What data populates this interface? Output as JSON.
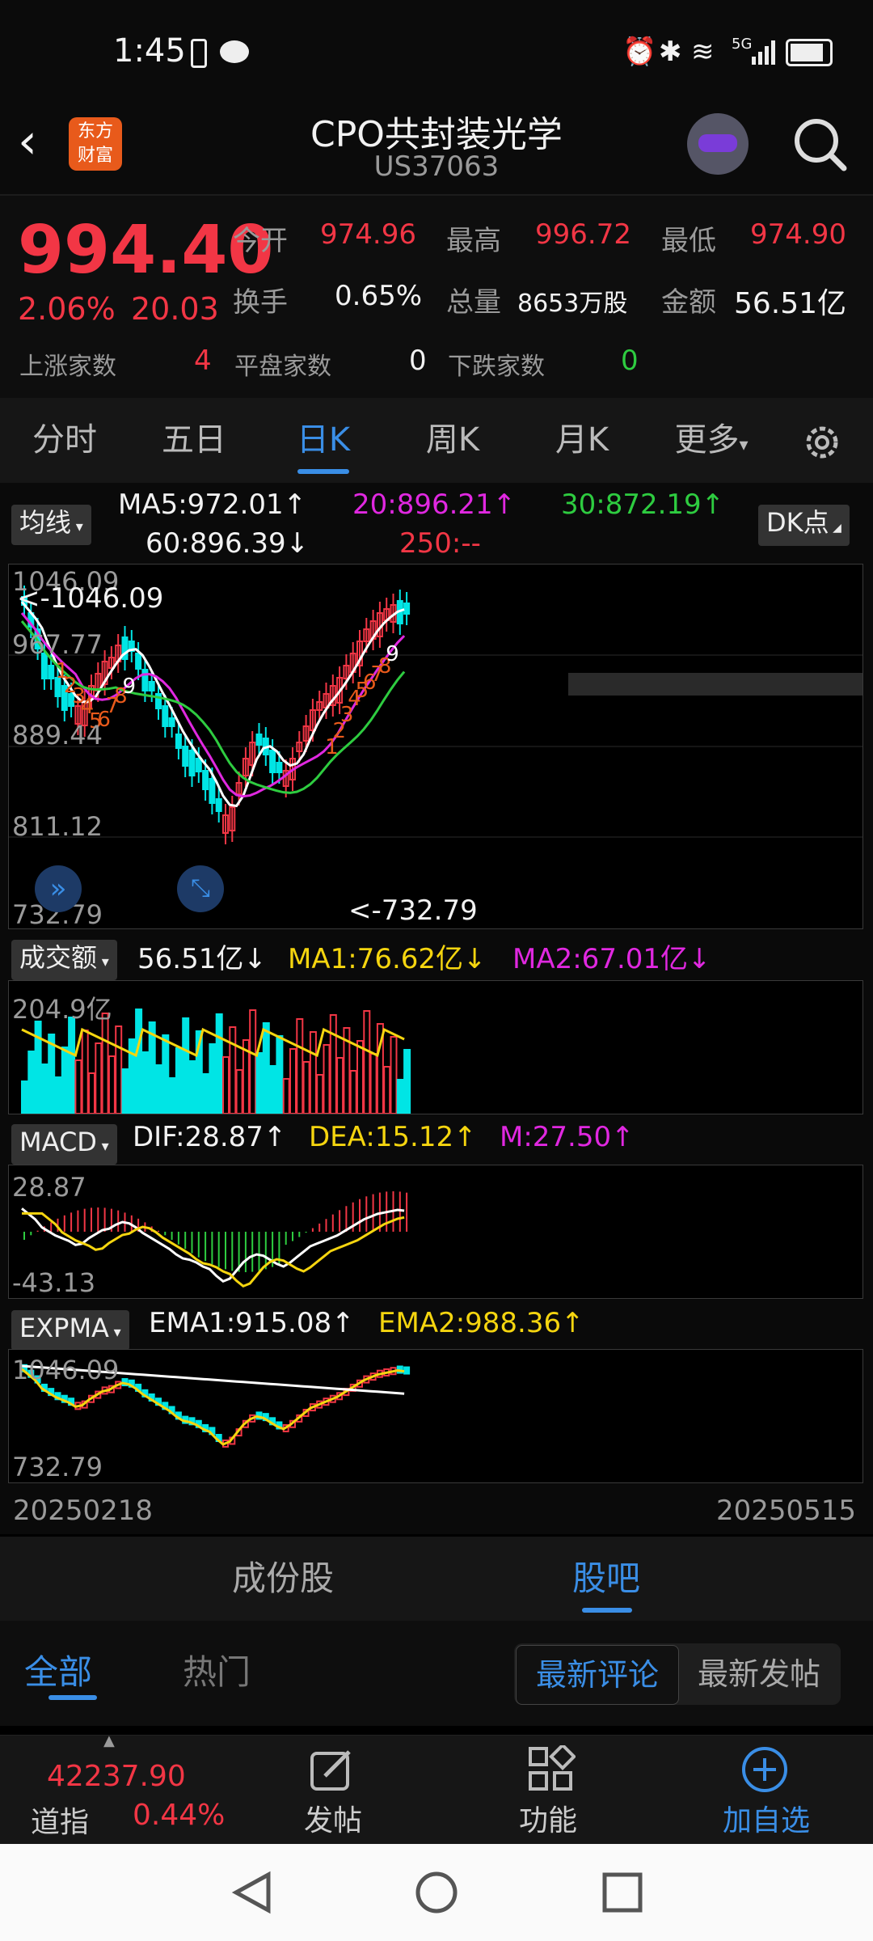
{
  "status_bar": {
    "time": "1:45",
    "network": "5G"
  },
  "header": {
    "logo_line1": "东方",
    "logo_line2": "财富",
    "title": "CPO共封装光学",
    "code": "US37063"
  },
  "quote": {
    "price": "994.40",
    "change_pct": "2.06%",
    "change_abs": "20.03",
    "open_label": "今开",
    "open": "974.96",
    "high_label": "最高",
    "high": "996.72",
    "low_label": "最低",
    "low": "974.90",
    "turnover_label": "换手",
    "turnover": "0.65%",
    "volume_label": "总量",
    "volume": "8653万股",
    "amount_label": "金额",
    "amount": "56.51亿",
    "up_label": "上涨家数",
    "up": "4",
    "flat_label": "平盘家数",
    "flat": "0",
    "down_label": "下跌家数",
    "down": "0"
  },
  "tabs": [
    {
      "label": "分时"
    },
    {
      "label": "五日"
    },
    {
      "label": "日K"
    },
    {
      "label": "周K"
    },
    {
      "label": "月K"
    },
    {
      "label": "更多"
    }
  ],
  "active_tab": "日K",
  "kline": {
    "indicator_btn": "均线",
    "dk_btn": "DK点",
    "ma5": "MA5:972.01↑",
    "ma20": "20:896.21↑",
    "ma30": "30:872.19↑",
    "ma60": "60:896.39↓",
    "ma250": "250:--",
    "y_labels": [
      "1046.09",
      "967.77",
      "889.44",
      "811.12",
      "732.79"
    ],
    "high_marker": "<-1046.09",
    "low_marker": "<-732.79",
    "td_down": [
      "1",
      "2",
      "3",
      "4",
      "5",
      "6",
      "7",
      "8",
      "9"
    ],
    "td_up": [
      "1",
      "2",
      "3",
      "4",
      "5",
      "6",
      "7",
      "8",
      "9"
    ]
  },
  "volume": {
    "btn": "成交额",
    "value": "56.51亿↓",
    "ma1": "MA1:76.62亿↓",
    "ma2": "MA2:67.01亿↓",
    "y_label": "204.9亿"
  },
  "macd": {
    "btn": "MACD",
    "dif": "DIF:28.87↑",
    "dea": "DEA:15.12↑",
    "m": "M:27.50↑",
    "y_top": "28.87",
    "y_bottom": "-43.13"
  },
  "expma": {
    "btn": "EXPMA",
    "ema1": "EMA1:915.08↑",
    "ema2": "EMA2:988.36↑",
    "y_top": "1046.09",
    "y_bottom": "732.79"
  },
  "date_range": {
    "start": "20250218",
    "end": "20250515"
  },
  "section_tabs": [
    {
      "label": "成份股"
    },
    {
      "label": "股吧"
    }
  ],
  "filter_tabs": [
    {
      "label": "全部"
    },
    {
      "label": "热门"
    }
  ],
  "sort_buttons": [
    {
      "label": "最新评论"
    },
    {
      "label": "最新发帖"
    }
  ],
  "bottom_bar": {
    "index_value": "42237.90",
    "index_name": "道指",
    "index_change": "0.44%",
    "post": "发帖",
    "function": "功能",
    "add_watch": "加自选"
  },
  "colors": {
    "up": "#f23645",
    "down": "#00e5e5",
    "accent": "#3a8ee6",
    "yellow": "#f5d50f",
    "magenta": "#e028e0",
    "green": "#2ecc40"
  },
  "chart_data": {
    "type": "candlestick",
    "x_range": [
      "20250218",
      "20250515"
    ],
    "price_range": [
      732.79,
      1046.09
    ],
    "high": 1046.09,
    "low": 732.79,
    "close_last": 994.4
  }
}
